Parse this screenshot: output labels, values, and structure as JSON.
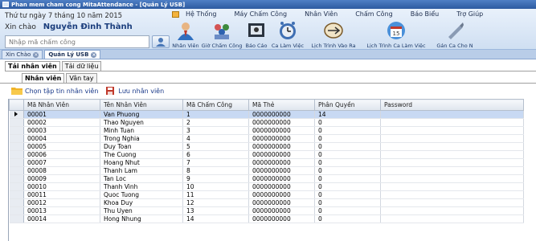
{
  "window": {
    "title": "Phan mem cham cong MitaAttendance - [Quản Lý USB]"
  },
  "header": {
    "date": "Thứ tư ngày 7 tháng 10 năm 2015",
    "greeting": "Xin chào",
    "user_name": "Nguyễn Đình Thành",
    "search_placeholder": "Nhập mã chấm công"
  },
  "menu": [
    "Hệ Thống",
    "Máy Chấm Công",
    "Nhân Viên",
    "Chấm Công",
    "Báo Biểu",
    "Trợ Giúp"
  ],
  "toolbar": [
    {
      "label": "Nhân Viên",
      "icon": "employees-icon"
    },
    {
      "label": "Giờ Chấm Công",
      "icon": "attendance-time-icon"
    },
    {
      "label": "Báo Cáo",
      "icon": "report-icon"
    },
    {
      "label": "Ca Làm Việc",
      "icon": "shift-clock-icon"
    },
    {
      "label": "Lịch Trình Vào Ra",
      "icon": "in-out-schedule-icon"
    },
    {
      "label": "Lịch Trình Ca Làm Việc",
      "icon": "shift-calendar-icon"
    },
    {
      "label": "Gán Ca Cho N",
      "icon": "assign-shift-icon"
    }
  ],
  "calendar_day": "15",
  "doc_tabs": [
    {
      "label": "Xin Chào",
      "active": false
    },
    {
      "label": "Quản Lý USB",
      "active": true
    }
  ],
  "sub_tabs": {
    "level1": [
      "Tải nhân viên",
      "Tải dữ liệu"
    ],
    "level2": [
      "Nhân viên",
      "Vân tay"
    ]
  },
  "actions": {
    "choose_file": "Chọn tập tin nhân viên",
    "save": "Lưu nhân viên"
  },
  "table": {
    "columns": [
      "Mã Nhân Viên",
      "Tên Nhân Viên",
      "Mã Chấm Công",
      "Mã Thẻ",
      "Phân Quyền",
      "Password"
    ],
    "rows": [
      [
        "00001",
        "Van Phuong",
        "1",
        "0000000000",
        "14",
        ""
      ],
      [
        "00002",
        "Thao Nguyen",
        "2",
        "0000000000",
        "0",
        ""
      ],
      [
        "00003",
        "Minh Tuan",
        "3",
        "0000000000",
        "0",
        ""
      ],
      [
        "00004",
        "Trong Nghia",
        "4",
        "0000000000",
        "0",
        ""
      ],
      [
        "00005",
        "Duy Toan",
        "5",
        "0000000000",
        "0",
        ""
      ],
      [
        "00006",
        "The Cuong",
        "6",
        "0000000000",
        "0",
        ""
      ],
      [
        "00007",
        "Hoang Nhut",
        "7",
        "0000000000",
        "0",
        ""
      ],
      [
        "00008",
        "Thanh Lam",
        "8",
        "0000000000",
        "0",
        ""
      ],
      [
        "00009",
        "Tan Loc",
        "9",
        "0000000000",
        "0",
        ""
      ],
      [
        "00010",
        "Thanh Vinh",
        "10",
        "0000000000",
        "0",
        ""
      ],
      [
        "00011",
        "Quoc Tuong",
        "11",
        "0000000000",
        "0",
        ""
      ],
      [
        "00012",
        "Khoa Duy",
        "12",
        "0000000000",
        "0",
        ""
      ],
      [
        "00013",
        "Thu Uyen",
        "13",
        "0000000000",
        "0",
        ""
      ],
      [
        "00014",
        "Hong Nhung",
        "14",
        "0000000000",
        "0",
        ""
      ]
    ]
  },
  "colors": {
    "title_bar": "#2c5aa0",
    "header_bg": "#dbe7f6",
    "selected_row": "#c8d9f3",
    "accent_text": "#1a3d7c"
  }
}
